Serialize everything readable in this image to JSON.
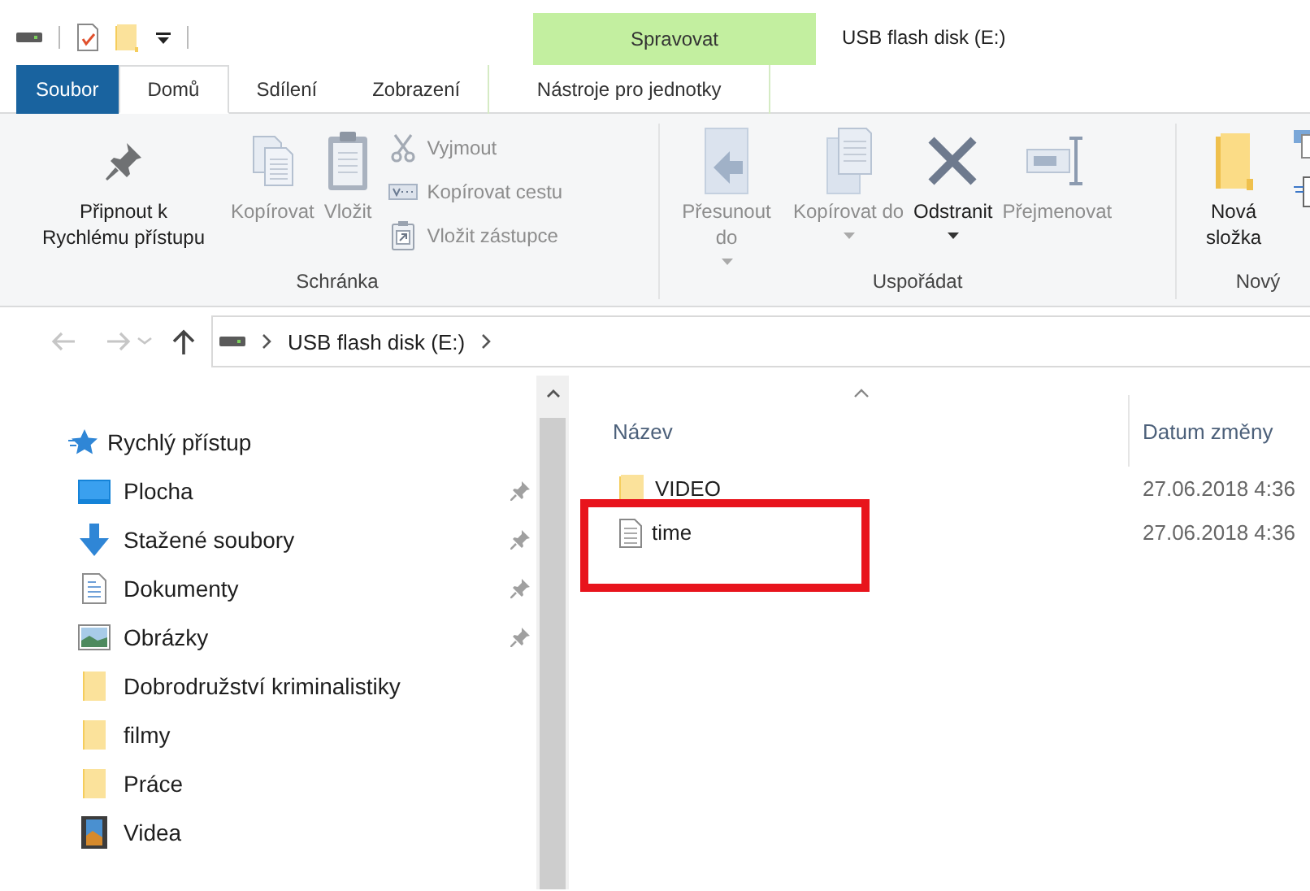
{
  "window": {
    "title": "USB flash disk (E:)"
  },
  "tabs": [
    {
      "label": "Soubor",
      "kind": "file",
      "selected": false
    },
    {
      "label": "Domů",
      "kind": "normal",
      "selected": true
    },
    {
      "label": "Sdílení",
      "kind": "normal",
      "selected": false
    },
    {
      "label": "Zobrazení",
      "kind": "normal",
      "selected": false
    },
    {
      "label": "Nástroje pro jednotky",
      "kind": "contextual",
      "group": "Spravovat",
      "selected": false
    }
  ],
  "ribbon": {
    "groups": [
      {
        "label": "Schránka",
        "commands": [
          {
            "label": "Připnout k Rychlému přístupu",
            "kind": "large",
            "disabled": false,
            "dropdown": false
          },
          {
            "label": "Kopírovat",
            "kind": "large",
            "disabled": true,
            "dropdown": false
          },
          {
            "label": "Vložit",
            "kind": "large",
            "disabled": true,
            "dropdown": false
          },
          {
            "label": "Vyjmout",
            "kind": "small",
            "disabled": true,
            "dropdown": false
          },
          {
            "label": "Kopírovat cestu",
            "kind": "small",
            "disabled": true,
            "dropdown": false
          },
          {
            "label": "Vložit zástupce",
            "kind": "small",
            "disabled": true,
            "dropdown": false
          }
        ]
      },
      {
        "label": "Uspořádat",
        "commands": [
          {
            "label": "Přesunout do",
            "kind": "large",
            "disabled": true,
            "dropdown": true
          },
          {
            "label": "Kopírovat do",
            "kind": "large",
            "disabled": true,
            "dropdown": true
          },
          {
            "label": "Odstranit",
            "kind": "large",
            "disabled": false,
            "dropdown": true
          },
          {
            "label": "Přejmenovat",
            "kind": "large",
            "disabled": true,
            "dropdown": false
          }
        ]
      },
      {
        "label": "Nový",
        "commands": [
          {
            "label": "Nová složka",
            "kind": "large",
            "disabled": false,
            "dropdown": false
          }
        ]
      }
    ]
  },
  "address": {
    "back_disabled": true,
    "forward_disabled": true,
    "path": [
      "USB flash disk (E:)"
    ]
  },
  "navigation": {
    "header": "Rychlý přístup",
    "items": [
      {
        "label": "Plocha",
        "kind": "desktop",
        "pinned": true
      },
      {
        "label": "Stažené soubory",
        "kind": "downloads",
        "pinned": true
      },
      {
        "label": "Dokumenty",
        "kind": "documents",
        "pinned": true
      },
      {
        "label": "Obrázky",
        "kind": "pictures",
        "pinned": true
      },
      {
        "label": "Dobrodružství kriminalistiky",
        "kind": "folder",
        "pinned": false
      },
      {
        "label": "filmy",
        "kind": "folder",
        "pinned": false
      },
      {
        "label": "Práce",
        "kind": "folder",
        "pinned": false
      },
      {
        "label": "Videa",
        "kind": "videos",
        "pinned": false
      }
    ]
  },
  "files": {
    "columns": [
      "Název",
      "Datum změny"
    ],
    "rows": [
      {
        "name": "VIDEO",
        "kind": "folder",
        "date": "27.06.2018 4:36",
        "highlighted": false
      },
      {
        "name": "time",
        "kind": "file",
        "date": "27.06.2018 4:36",
        "highlighted": true
      }
    ]
  }
}
